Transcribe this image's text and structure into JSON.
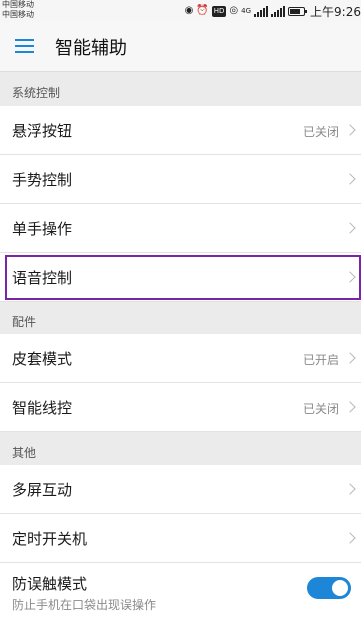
{
  "status_bar": {
    "carrier_1": "中国移动",
    "carrier_2": "中国移动",
    "network_label": "4G",
    "hd_label": "HD",
    "time": "上午9:26",
    "icons": [
      "hotspot-icon",
      "alarm-icon",
      "hd-icon",
      "eye-icon",
      "signal-icon",
      "signal-icon",
      "battery-icon"
    ]
  },
  "header": {
    "title": "智能辅助",
    "menu_icon": "menu-icon",
    "accent_color": "#1e86d6"
  },
  "sections": {
    "system": {
      "title": "系统控制",
      "items": [
        {
          "label": "悬浮按钮",
          "value": "已关闭"
        },
        {
          "label": "手势控制",
          "value": ""
        },
        {
          "label": "单手操作",
          "value": ""
        },
        {
          "label": "语音控制",
          "value": ""
        }
      ]
    },
    "accessories": {
      "title": "配件",
      "items": [
        {
          "label": "皮套模式",
          "value": "已开启"
        },
        {
          "label": "智能线控",
          "value": "已关闭"
        }
      ]
    },
    "other": {
      "title": "其他",
      "items": [
        {
          "label": "多屏互动",
          "value": ""
        },
        {
          "label": "定时开关机",
          "value": ""
        },
        {
          "label": "防误触模式",
          "subtitle": "防止手机在口袋出现误操作",
          "toggle_on": true
        }
      ]
    }
  },
  "highlight_color": "#7a24a8"
}
